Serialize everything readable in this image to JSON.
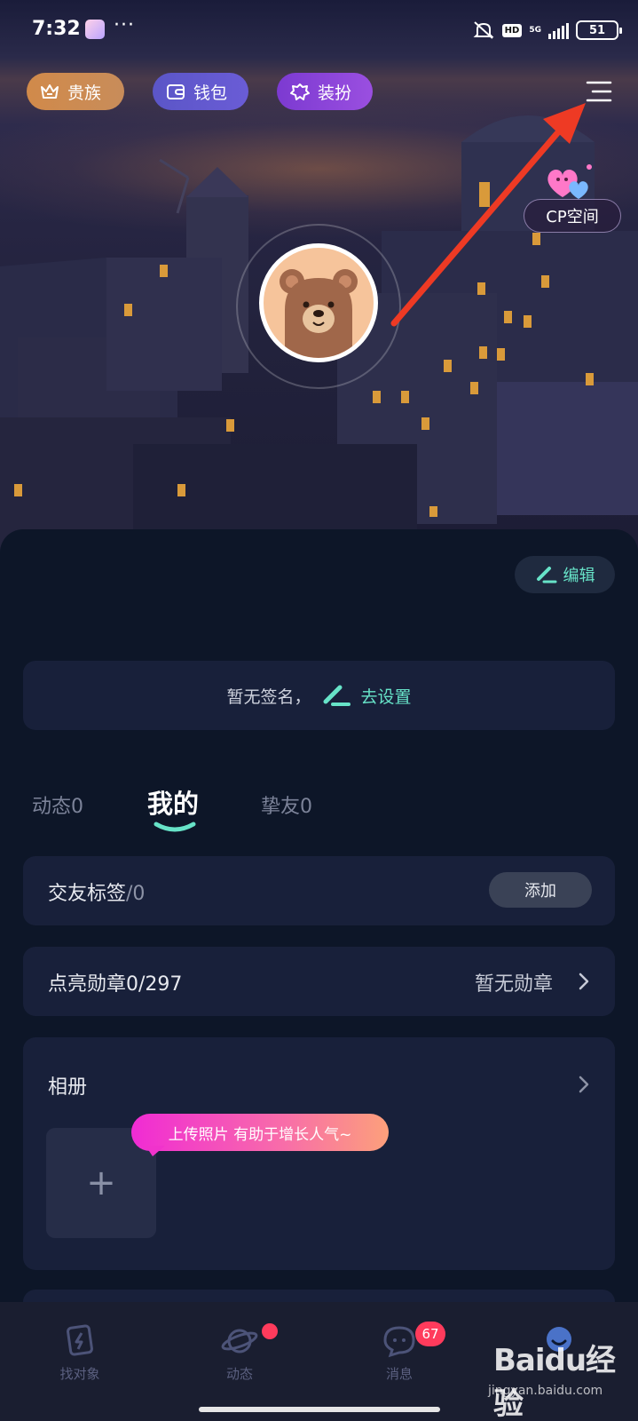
{
  "status_bar": {
    "time": "7:32",
    "dots": "···",
    "hd": "HD",
    "network": "5G",
    "battery": "51"
  },
  "top_pills": {
    "noble": "贵族",
    "wallet": "钱包",
    "dress_up": "装扮"
  },
  "cp_space": {
    "label": "CP空间"
  },
  "profile": {
    "edit_label": "编辑",
    "signature_empty": "暂无签名，",
    "signature_action": "去设置"
  },
  "tabs": {
    "dynamics": "动态0",
    "mine": "我的",
    "close_friends": "挚友0"
  },
  "friend_tags": {
    "label": "交友标签",
    "count": "/0",
    "add_label": "添加"
  },
  "medals": {
    "label": "点亮勋章0/297",
    "status": "暂无勋章"
  },
  "album": {
    "label": "相册",
    "upload_plus": "+",
    "tip": "上传照片 有助于增长人气~"
  },
  "bottom_nav": {
    "find": "找对象",
    "dynamics": "动态",
    "messages": "消息",
    "messages_badge": "67"
  },
  "watermark": {
    "logo": "Baidu经验",
    "url": "jingyan.baidu.com"
  },
  "colors": {
    "accent": "#67e3c8",
    "background": "#0d1628",
    "card": "#18203a",
    "badge": "#ff3b5c",
    "arrow": "#ee3a24"
  }
}
